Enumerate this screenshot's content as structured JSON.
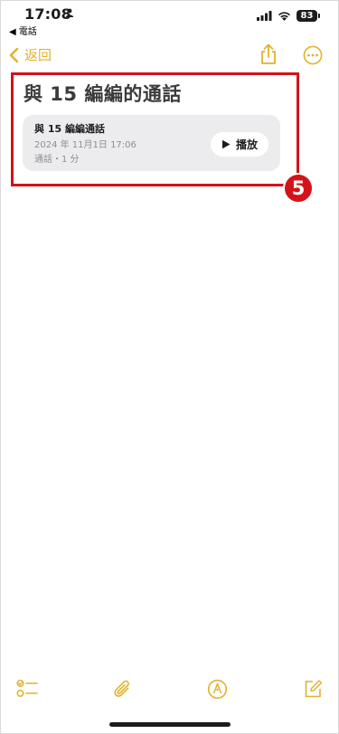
{
  "status_bar": {
    "time": "17:08",
    "back_app": "◀ 電話",
    "battery": "83"
  },
  "nav": {
    "back_label": "返回"
  },
  "note": {
    "title": "與 15 編編的通話",
    "card": {
      "title": "與 15 編編通話",
      "date": "2024 年 11月1日 17:06",
      "meta": "通話・1 分",
      "play_label": "播放"
    }
  },
  "annotation": {
    "step_number": "5"
  },
  "colors": {
    "accent": "#e3b12b",
    "highlight": "#d4121a",
    "card_bg": "#ececee"
  }
}
